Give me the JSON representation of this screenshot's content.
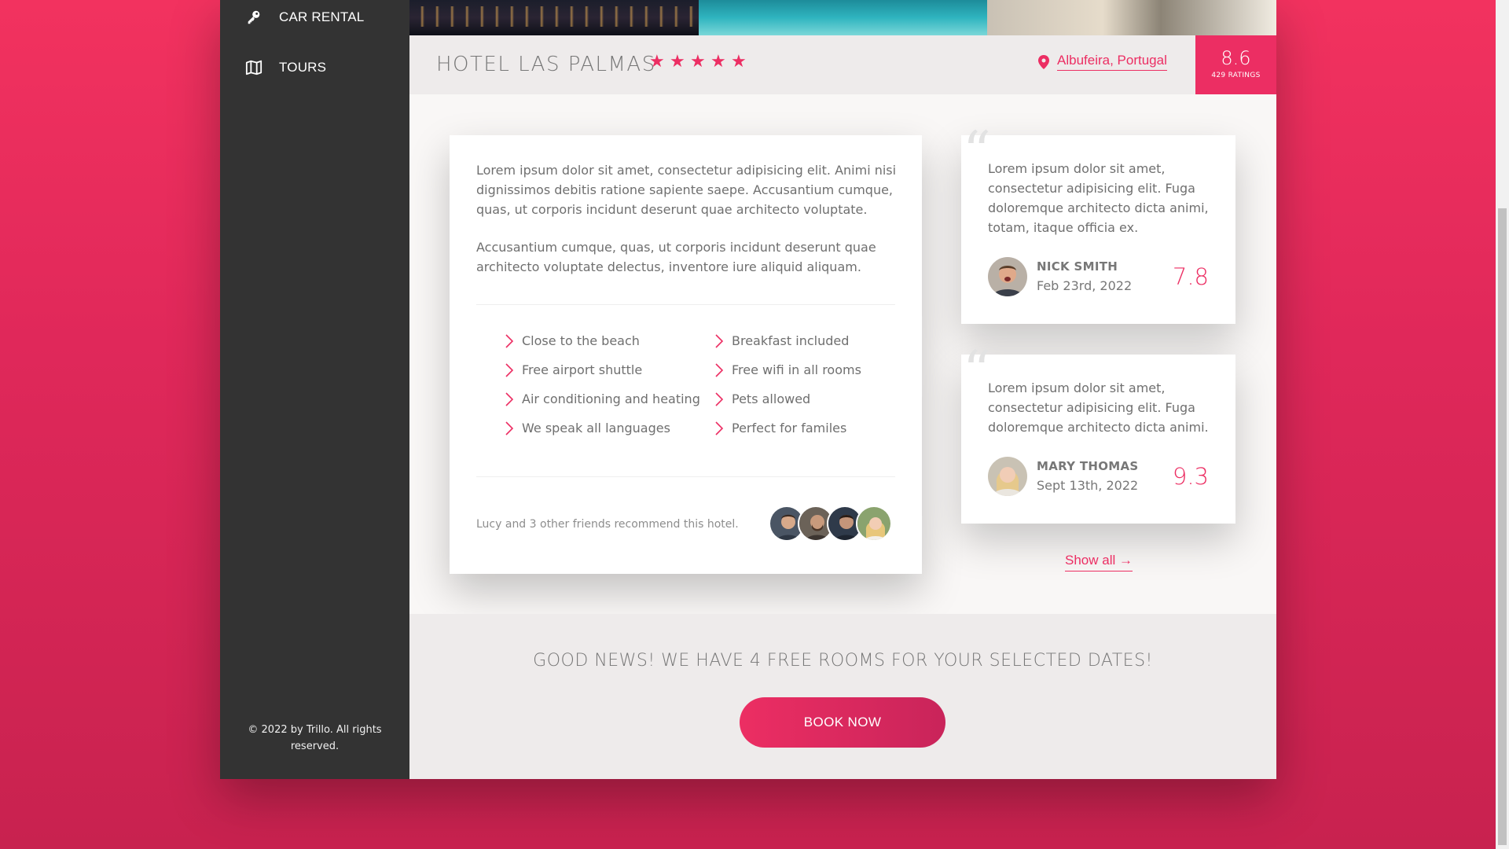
{
  "sidebar": {
    "items": [
      {
        "label": "CAR RENTAL",
        "icon": "key-icon"
      },
      {
        "label": "TOURS",
        "icon": "map-icon"
      }
    ],
    "legal": "© 2022 by Trillo. All rights reserved."
  },
  "hotel": {
    "name": "HOTEL LAS PALMAS",
    "stars": 5,
    "location": "Albufeira, Portugal",
    "rating": "8.6",
    "rating_count": "429 RATINGS"
  },
  "description": {
    "paragraph_1": "Lorem ipsum dolor sit amet, consectetur adipisicing elit. Animi nisi dignissimos debitis ratione sapiente saepe. Accusantium cumque, quas, ut corporis incidunt deserunt quae architecto voluptate.",
    "paragraph_2": "Accusantium cumque, quas, ut corporis incidunt deserunt quae architecto voluptate delectus, inventore iure aliquid aliquam.",
    "features": [
      "Close to the beach",
      "Breakfast included",
      "Free airport shuttle",
      "Free wifi in all rooms",
      "Air conditioning and heating",
      "Pets allowed",
      "We speak all languages",
      "Perfect for familes"
    ],
    "recommend": "Lucy and 3 other friends recommend this hotel."
  },
  "reviews": [
    {
      "text": "Lorem ipsum dolor sit amet, consectetur adipisicing elit. Fuga doloremque architecto dicta animi, totam, itaque officia ex.",
      "name": "NICK SMITH",
      "date": "Feb 23rd, 2022",
      "score": "7.8"
    },
    {
      "text": "Lorem ipsum dolor sit amet, consectetur adipisicing elit. Fuga doloremque architecto dicta animi.",
      "name": "MARY THOMAS",
      "date": "Sept 13th, 2022",
      "score": "9.3"
    }
  ],
  "show_all": "Show all →",
  "cta": {
    "text": "GOOD NEWS! WE HAVE 4 FREE ROOMS FOR YOUR SELECTED DATES!",
    "button": "BOOK NOW"
  },
  "colors": {
    "accent": "#ec2e63",
    "sidebar": "#333333",
    "background_gradient": "#f2325f"
  }
}
